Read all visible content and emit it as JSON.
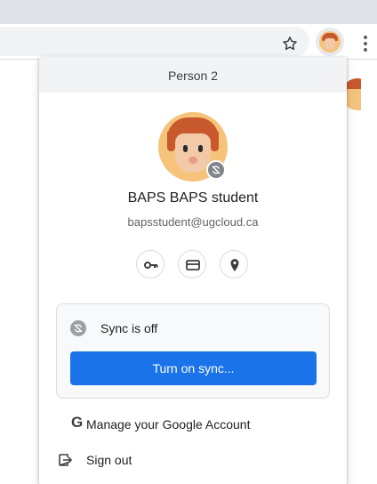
{
  "menu": {
    "header_title": "Person 2",
    "profile": {
      "name": "BAPS BAPS student",
      "email": "bapsstudent@ugcloud.ca"
    },
    "quick_icons": [
      "key-icon",
      "credit-card-icon",
      "location-pin-icon"
    ],
    "sync": {
      "status": "Sync is off",
      "button_label": "Turn on sync..."
    },
    "items": [
      {
        "icon": "google-g-icon",
        "glyph": "G",
        "label": "Manage your Google Account"
      },
      {
        "icon": "sign-out-icon",
        "label": "Sign out"
      }
    ]
  },
  "colors": {
    "accent": "#1a73e8",
    "header_bg": "#f1f3f4",
    "avatar_hair": "#c8592d",
    "avatar_bg": "#f6c37a"
  }
}
